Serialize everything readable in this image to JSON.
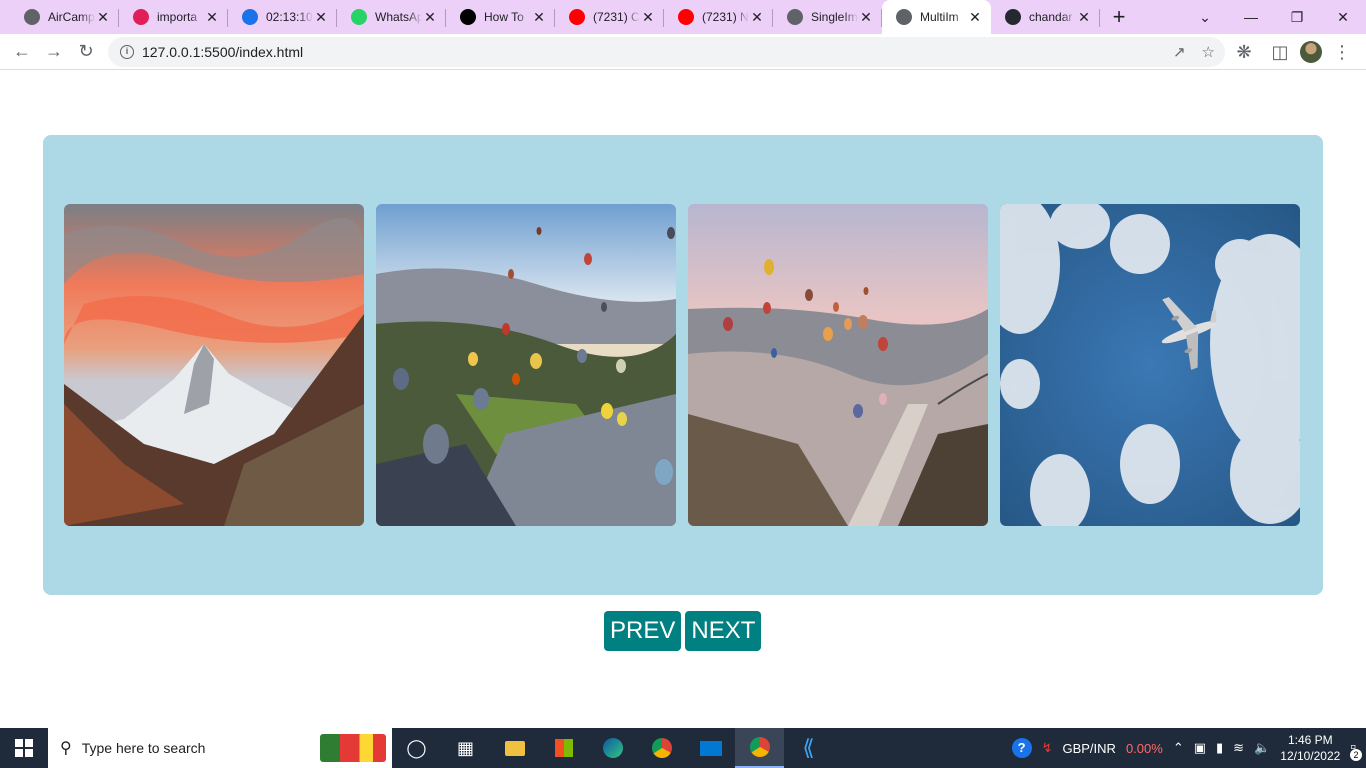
{
  "browser": {
    "tabs": [
      {
        "title": "AirCamp",
        "favicon": "globe-icon",
        "color": "#5f6368"
      },
      {
        "title": "importa",
        "favicon": "slack-icon",
        "color": "#e01e5a"
      },
      {
        "title": "02:13:10",
        "favicon": "check-circle-icon",
        "color": "#1a73e8"
      },
      {
        "title": "WhatsAp",
        "favicon": "whatsapp-icon",
        "color": "#25d366"
      },
      {
        "title": "How To",
        "favicon": "medium-icon",
        "color": "#000000"
      },
      {
        "title": "(7231) C",
        "favicon": "youtube-icon",
        "color": "#ff0000"
      },
      {
        "title": "(7231) N",
        "favicon": "youtube-icon",
        "color": "#ff0000"
      },
      {
        "title": "SingleIm",
        "favicon": "globe-icon",
        "color": "#5f6368"
      },
      {
        "title": "MultiIm",
        "favicon": "globe-icon",
        "color": "#5f6368",
        "active": true
      },
      {
        "title": "chandar",
        "favicon": "github-icon",
        "color": "#24292f"
      }
    ],
    "url": "127.0.0.1:5500/index.html"
  },
  "carousel": {
    "slides": [
      {
        "name": "sunset-mountain-image"
      },
      {
        "name": "balloons-valley-image"
      },
      {
        "name": "balloons-canyon-image"
      },
      {
        "name": "airplane-sky-image"
      }
    ],
    "prev_label": "PREV",
    "next_label": "NEXT",
    "background_color": "#add8e6",
    "button_color": "#008080"
  },
  "taskbar": {
    "search_placeholder": "Type here to search",
    "ticker_label": "GBP/INR",
    "ticker_change": "0.00%",
    "time": "1:46 PM",
    "date": "12/10/2022",
    "notification_count": "2"
  }
}
